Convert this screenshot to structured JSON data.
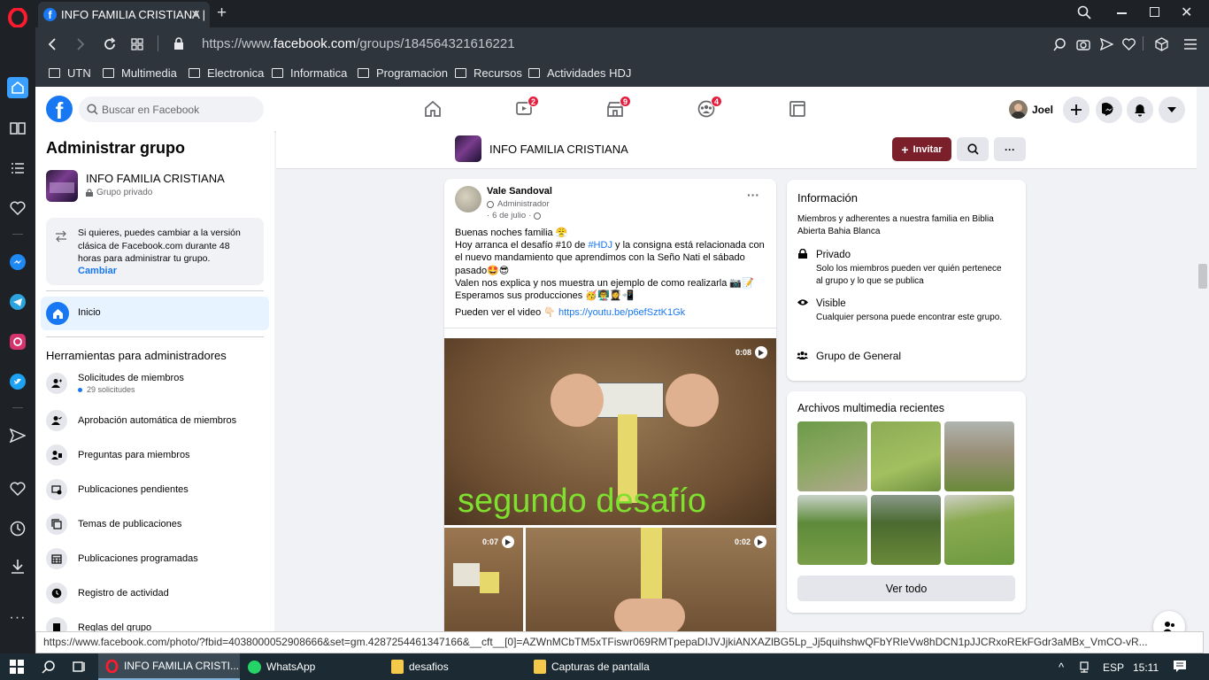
{
  "browser": {
    "tab_title": "INFO FAMILIA CRISTIANA |",
    "url_prefix": "https://www.",
    "url_domain": "facebook.com",
    "url_path": "/groups/184564321616221",
    "bookmarks": [
      "UTN",
      "Multimedia",
      "Electronica",
      "Informatica",
      "Programacion",
      "Recursos",
      "Actividades HDJ"
    ],
    "status_url": "https://www.facebook.com/photo/?fbid=4038000052908666&set=gm.4287254461347166&__cft__[0]=AZWnMCbTM5xTFiswr069RMTpepaDIJVJjkiANXAZlBG5Lp_Jj5quihshwQFbYRleVw8hDCN1pJJCRxoREkFGdr3aMBx_VmCO-vR..."
  },
  "fb_nav": {
    "search_placeholder": "Buscar en Facebook",
    "badges": {
      "watch": "2",
      "marketplace": "9",
      "groups": "4"
    },
    "user_name": "Joel"
  },
  "left_panel": {
    "title": "Administrar grupo",
    "group_name": "INFO FAMILIA CRISTIANA",
    "group_privacy": "Grupo privado",
    "notice_text": "Si quieres, puedes cambiar a la versión clásica de Facebook.com durante 48 horas para administrar tu grupo.",
    "notice_link": "Cambiar",
    "home_label": "Inicio",
    "tools_title": "Herramientas para administradores",
    "tools": [
      {
        "label": "Solicitudes de miembros",
        "sub": "29 solicitudes"
      },
      {
        "label": "Aprobación automática de miembros"
      },
      {
        "label": "Preguntas para miembros"
      },
      {
        "label": "Publicaciones pendientes"
      },
      {
        "label": "Temas de publicaciones"
      },
      {
        "label": "Publicaciones programadas"
      },
      {
        "label": "Registro de actividad"
      },
      {
        "label": "Reglas del grupo"
      }
    ]
  },
  "group_header": {
    "name": "INFO FAMILIA CRISTIANA",
    "invite_label": "Invitar"
  },
  "post": {
    "author": "Vale Sandoval",
    "role": "Administrador",
    "date": "6 de julio",
    "lines": [
      "Buenas noches familia 😤",
      "Hoy arranca el desafío #10 de ",
      " y la consigna está relacionada con",
      "el nuevo mandamiento que aprendimos con la Seño Nati el sábado",
      "pasado🤩😎",
      "Valen nos explica y nos muestra un ejemplo de como realizarla 📷📝",
      "Esperamos sus producciones 🥳👨‍🏫👩‍🎓📲"
    ],
    "hashtag": "#HDJ",
    "video_prefix": "Pueden ver el video 👇🏻 ",
    "video_link": "https://youtu.be/p6efSztK1Gk",
    "media_main_time": "0:08",
    "media_main_caption": "segundo desafío",
    "media_left_time": "0:07",
    "media_right_time": "0:02"
  },
  "info_card": {
    "title": "Información",
    "description": "Miembros y adherentes a nuestra familia en Biblia Abierta Bahia Blanca",
    "private_title": "Privado",
    "private_desc": "Solo los miembros pueden ver quién pertenece al grupo y lo que se publica",
    "visible_title": "Visible",
    "visible_desc": "Cualquier persona puede encontrar este grupo.",
    "general_title": "Grupo de General"
  },
  "media_card": {
    "title": "Archivos multimedia recientes",
    "see_all": "Ver todo"
  },
  "taskbar": {
    "apps": [
      "INFO FAMILIA CRISTI...",
      "WhatsApp",
      "desafios",
      "Capturas de pantalla"
    ],
    "lang": "ESP",
    "time": "15:11"
  },
  "colors": {
    "fb_blue": "#1877f2",
    "invite_button": "#7b1f2a",
    "caption_green": "#7fe030"
  }
}
